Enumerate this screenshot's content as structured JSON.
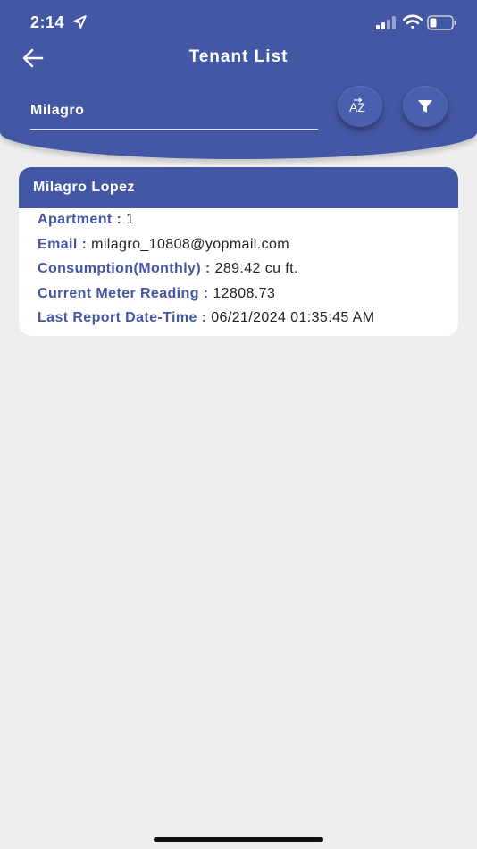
{
  "status_bar": {
    "time": "2:14"
  },
  "header": {
    "title": "Tenant List",
    "search_value": "Milagro",
    "sort_label": "AZ"
  },
  "tenant": {
    "name": "Milagro Lopez",
    "fields": [
      {
        "label": "Apartment :",
        "value": "1"
      },
      {
        "label": "Email :",
        "value": "milagro_10808@yopmail.com"
      },
      {
        "label": "Consumption(Monthly) :",
        "value": "289.42 cu ft."
      },
      {
        "label": "Current Meter Reading :",
        "value": "12808.73"
      },
      {
        "label": "Last Report Date-Time :",
        "value": "06/21/2024 01:35:45 AM"
      }
    ]
  },
  "colors": {
    "primary": "#4357a4",
    "background": "#eeeeee",
    "card": "#ffffff"
  },
  "icons": [
    "back-arrow-icon",
    "sort-az-icon",
    "filter-icon",
    "location-arrow-icon",
    "signal-icon",
    "wifi-icon",
    "battery-icon"
  ]
}
